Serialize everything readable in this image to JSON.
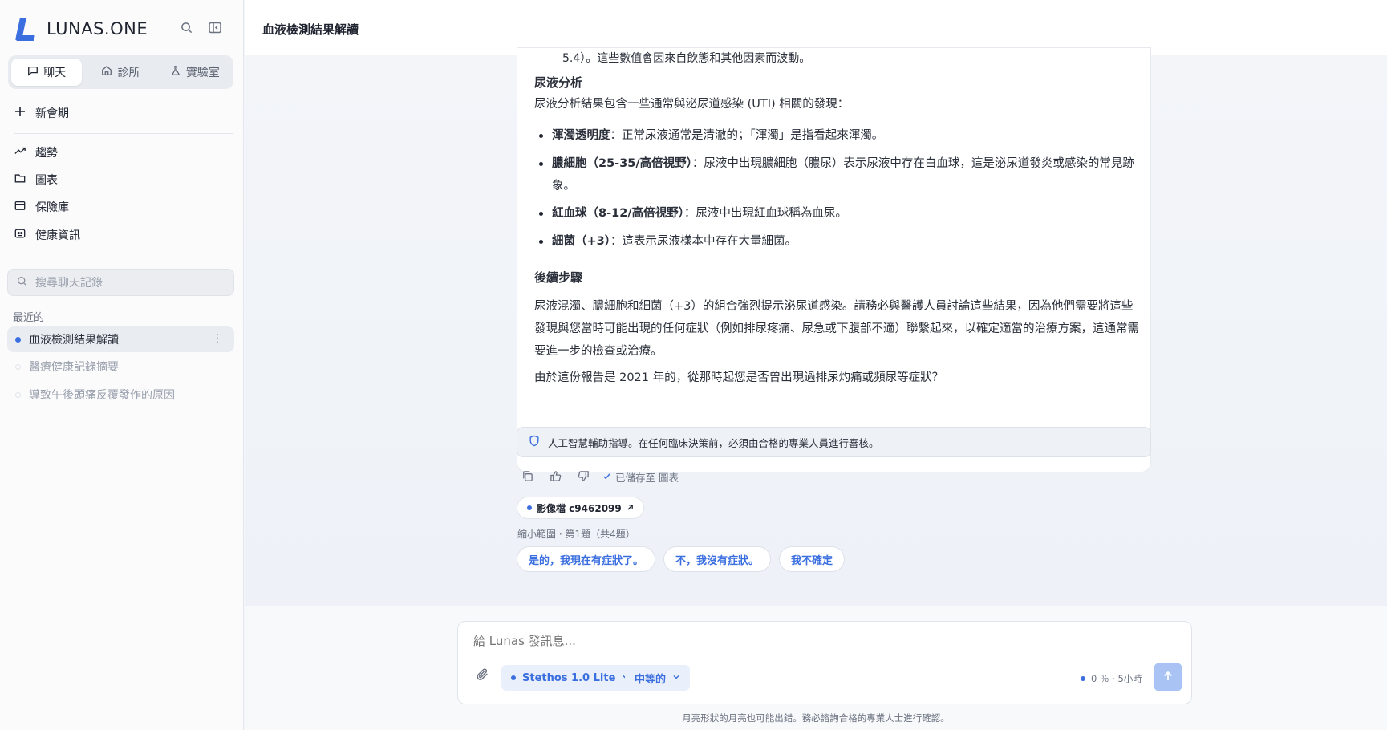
{
  "brand": {
    "name": "LUNAS.ONE"
  },
  "sidebar": {
    "tabs": [
      {
        "label": "聊天",
        "icon": "chat-icon"
      },
      {
        "label": "診所",
        "icon": "clinic-icon"
      },
      {
        "label": "實驗室",
        "icon": "flask-icon"
      }
    ],
    "new_session": "新會期",
    "nav": [
      {
        "label": "趨勢",
        "icon": "trend-icon"
      },
      {
        "label": "圖表",
        "icon": "folder-icon"
      },
      {
        "label": "保險庫",
        "icon": "vault-icon"
      },
      {
        "label": "健康資訊",
        "icon": "health-info-icon"
      }
    ],
    "search_placeholder": "搜尋聊天記錄",
    "recent_label": "最近的",
    "recent": [
      {
        "label": "血液檢測結果解讀"
      },
      {
        "label": "醫療健康記錄摘要"
      },
      {
        "label": "導致午後頭痛反覆發作的原因"
      }
    ]
  },
  "header": {
    "title": "血液檢測結果解讀"
  },
  "message": {
    "cut_line": "5.4）。這些數值會因來自飲態和其他因素而波動。",
    "urine_heading": "尿液分析",
    "urine_intro": "尿液分析結果包含一些通常與泌尿道感染 (UTI) 相關的發現：",
    "bullets": [
      {
        "term": "渾濁透明度",
        "text": "：正常尿液通常是清澈的；「渾濁」是指看起來渾濁。"
      },
      {
        "term": "膿細胞（25-35/高倍視野）",
        "text": "：尿液中出現膿細胞（膿尿）表示尿液中存在白血球，這是泌尿道發炎或感染的常見跡象。"
      },
      {
        "term": "紅血球（8-12/高倍視野）",
        "text": "：尿液中出現紅血球稱為血尿。"
      },
      {
        "term": "細菌（+3）",
        "text": "：這表示尿液樣本中存在大量細菌。"
      }
    ],
    "next_heading": "後續步驟",
    "next_para": "尿液混濁、膿細胞和細菌（+3）的組合強烈提示泌尿道感染。請務必與醫護人員討論這些結果，因為他們需要將這些發現與您當時可能出現的任何症狀（例如排尿疼痛、尿急或下腹部不適）聯繫起來，以確定適當的治療方案，這通常需要進一步的檢查或治療。",
    "question": "由於這份報告是 2021 年的，從那時起您是否曾出現過排尿灼痛或頻尿等症狀？"
  },
  "notice": {
    "text": "人工智慧輔助指導。在任何臨床決策前，必須由合格的專業人員進行審核。"
  },
  "actions": {
    "saved": "已儲存至 圖表"
  },
  "file_chip": {
    "label": "影像檔 c9462099"
  },
  "narrow": {
    "text": "縮小範圍 · 第1題（共4題）"
  },
  "replies": [
    "是的，我現在有症狀了。",
    "不，我沒有症狀。",
    "我不確定"
  ],
  "composer": {
    "placeholder": "給 Lunas 發訊息...",
    "model": "Stethos 1.0 Lite",
    "level": "中等的",
    "context": "0 ％ · 5小時",
    "disclaimer": "月亮形狀的月亮也可能出錯。務必諮詢合格的專業人士進行確認。"
  },
  "colors": {
    "accent": "#3b6fe0",
    "send_disabled": "#a9c3f5"
  }
}
